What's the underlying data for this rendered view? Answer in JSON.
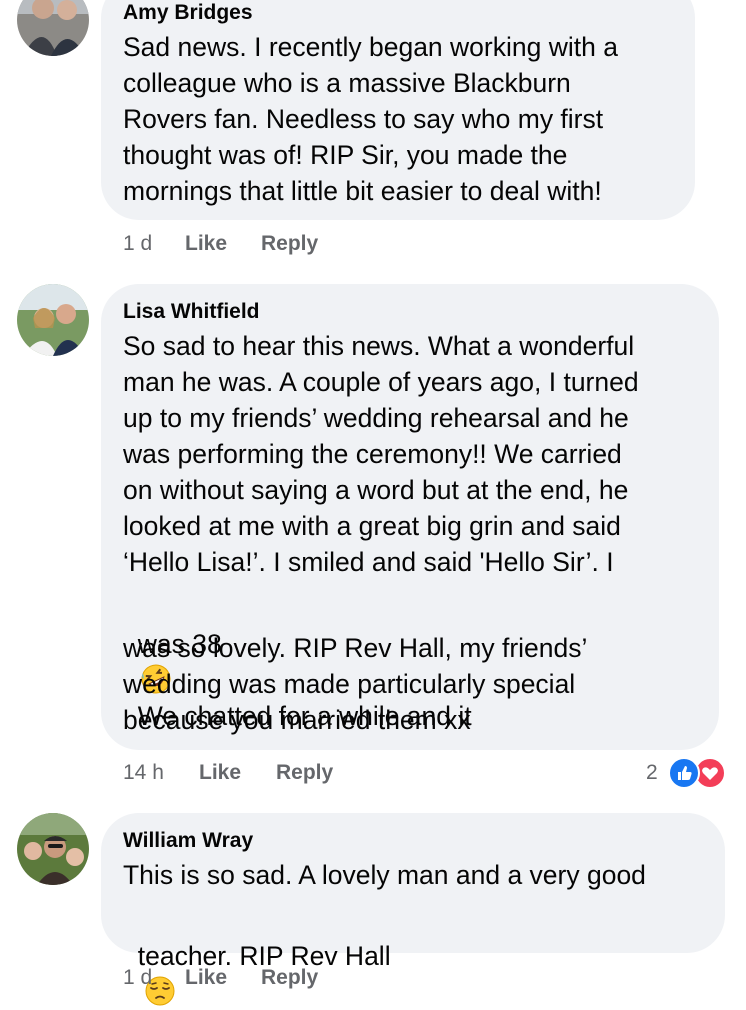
{
  "comments": [
    {
      "author": "Amy Bridges",
      "lines": [
        "Sad news. I recently began working with a",
        "colleague who is a massive Blackburn",
        "Rovers fan. Needless to say who my first",
        "thought was of! RIP Sir, you made the",
        "mornings that little bit easier to deal with!"
      ],
      "time": "1 d",
      "like": "Like",
      "reply": "Reply"
    },
    {
      "author": "Lisa Whitfield",
      "lines": [
        "So sad to hear this news. What a wonderful",
        "man he was. A couple of years ago, I turned",
        "up to my friends’ wedding rehearsal and he",
        "was performing the ceremony!! We carried",
        "on without saying a word but at the end, he",
        "looked at me with a great big grin and said",
        "‘Hello Lisa!’. I smiled and said 'Hello Sir’. I"
      ],
      "line8_a": "was 38",
      "line8_b": "We chatted for a while and it",
      "lines_end": [
        "was so lovely. RIP Rev Hall, my friends’",
        "wedding was made particularly special",
        "because you married them xx"
      ],
      "time": "14 h",
      "like": "Like",
      "reply": "Reply",
      "reaction_count": "2",
      "reactions": [
        "like-reaction-icon",
        "love-reaction-icon"
      ],
      "emoji": "rolling-laughing-emoji"
    },
    {
      "author": "William Wray",
      "line1": "This is so sad. A lovely man and a very good",
      "line2": "teacher. RIP Rev Hall",
      "emoji": "pensive-face-emoji",
      "time": "1 d",
      "like": "Like",
      "reply": "Reply"
    }
  ],
  "colors": {
    "bubble": "#f0f2f5",
    "meta": "#65676b",
    "like_blue": "#1877f2",
    "love_red": "#f33e58"
  }
}
